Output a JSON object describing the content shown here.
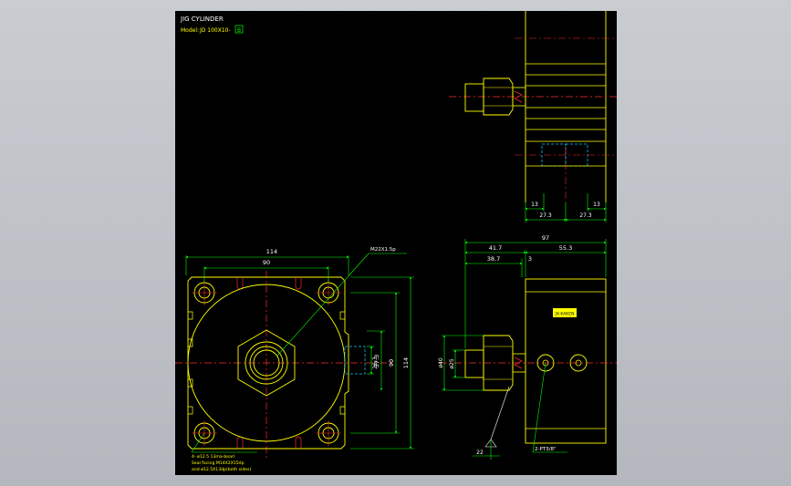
{
  "drawing": {
    "title": "JIG CYLINDER",
    "model_label": "Model:",
    "model_value": "JD 100X10-",
    "model_box": "B",
    "background": "#000000",
    "viewport_bg": "#c0c3c8"
  },
  "colors": {
    "outline": "#ffff00",
    "dimension": "#00ff00",
    "centerline": "#ff2a2a",
    "hidden": "#00c8ff",
    "annotation": "#ffffff",
    "text": "#ffffff"
  },
  "front_view": {
    "dims": {
      "width_114": "114",
      "width_90": "90",
      "height_114": "114",
      "height_90": "90",
      "height_37_3": "37.3",
      "height_26_3": "26.3"
    },
    "thread_callout": "M22X1.5p",
    "hole_note_1": "4- ø12.5 13ma-bearl",
    "hole_note_2": "Seal facing  M14X2X15dp",
    "hole_note_3": "and ø12.5X13dp(both sides)"
  },
  "side_view": {
    "dims": {
      "total_97": "97",
      "rod_41_7": "41.7",
      "body_55_3": "55.3",
      "rod_38_7": "38.7",
      "gap_3": "3",
      "dia_25": "ø25",
      "dia_40": "ø40",
      "stroke_22": "22"
    },
    "port_callout": "2-PT3/8\"",
    "brand_label": "JX-KAKEN"
  },
  "top_view": {
    "dims": {
      "left_13": "13",
      "right_13": "13",
      "left_27_3": "27.3",
      "right_27_3": "27.3"
    }
  }
}
